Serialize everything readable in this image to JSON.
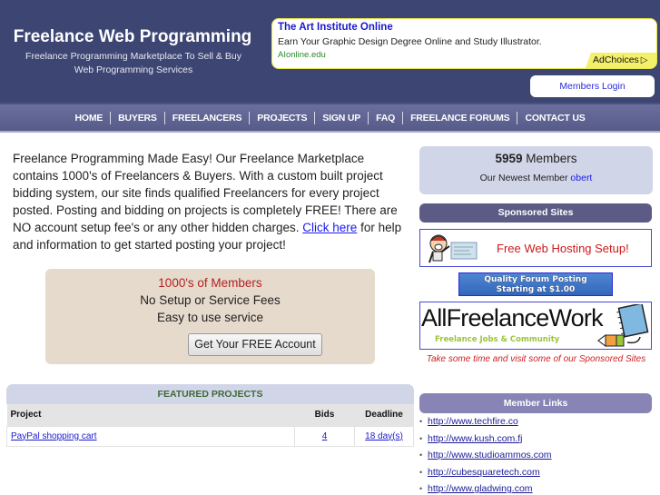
{
  "header": {
    "title": "Freelance Web Programming",
    "tagline": "Freelance Programming Marketplace To Sell & Buy Web Programming Services",
    "members_login": "Members Login"
  },
  "ad": {
    "title": "The Art Institute Online",
    "text": "Earn Your Graphic Design Degree Online and Study Illustrator.",
    "url": "AIonline.edu",
    "adchoices": "AdChoices",
    "adchoices_icon": "play-triangle-icon"
  },
  "nav": {
    "items": [
      {
        "label": "HOME"
      },
      {
        "label": "BUYERS"
      },
      {
        "label": "FREELANCERS"
      },
      {
        "label": "PROJECTS"
      },
      {
        "label": "SIGN UP"
      },
      {
        "label": "FAQ"
      },
      {
        "label": "FREELANCE FORUMS"
      },
      {
        "label": "CONTACT US"
      }
    ]
  },
  "intro": {
    "text_before": "Freelance Programming Made Easy! Our Freelance Marketplace contains 1000's of Freelancers & Buyers. With a custom built project bidding system, our site finds qualified Freelancers for every project posted. Posting and bidding on projects is completely FREE! There are NO account setup fee's or any other hidden charges. ",
    "link": "Click here",
    "text_after": " for help and information to get started posting your project!"
  },
  "promo": {
    "line1": "1000's of Members",
    "line2": "No Setup or Service Fees",
    "line3": "Easy to use service",
    "button": "Get Your FREE Account"
  },
  "featured_projects": {
    "title": "FEATURED PROJECTS",
    "columns": [
      "Project",
      "Bids",
      "Deadline"
    ],
    "rows": [
      {
        "project": "PayPal shopping cart",
        "bids": "4",
        "deadline": "18 day(s)"
      }
    ]
  },
  "sidebar": {
    "member_count": "5959",
    "members_label": "Members",
    "newest_label": "Our Newest Member",
    "newest_member": "obert",
    "sponsored_header": "Sponsored Sites",
    "hosting_ad": "Free Web Hosting Setup!",
    "forum_ad_line1": "Quality Forum Posting",
    "forum_ad_line2": "Starting at $1.00",
    "afw_logo": "AllFreelanceWork",
    "afw_sub": "Freelance Jobs & Community",
    "visit_text": "Take some time and visit some of our Sponsored Sites",
    "member_links_header": "Member Links",
    "member_links": [
      "http://www.techfire.co",
      "http://www.kush.com.fj",
      "http://www.studioammos.com",
      "http://cubesquaretech.com",
      "http://www.gladwing.com"
    ]
  },
  "colors": {
    "header_bg": "#3d4673",
    "link": "#1a1aee",
    "promo_red": "#b22222",
    "sponsored_header": "#5c5b86",
    "member_links_header": "#8884b5",
    "panel_bg": "#d0d5e8"
  }
}
